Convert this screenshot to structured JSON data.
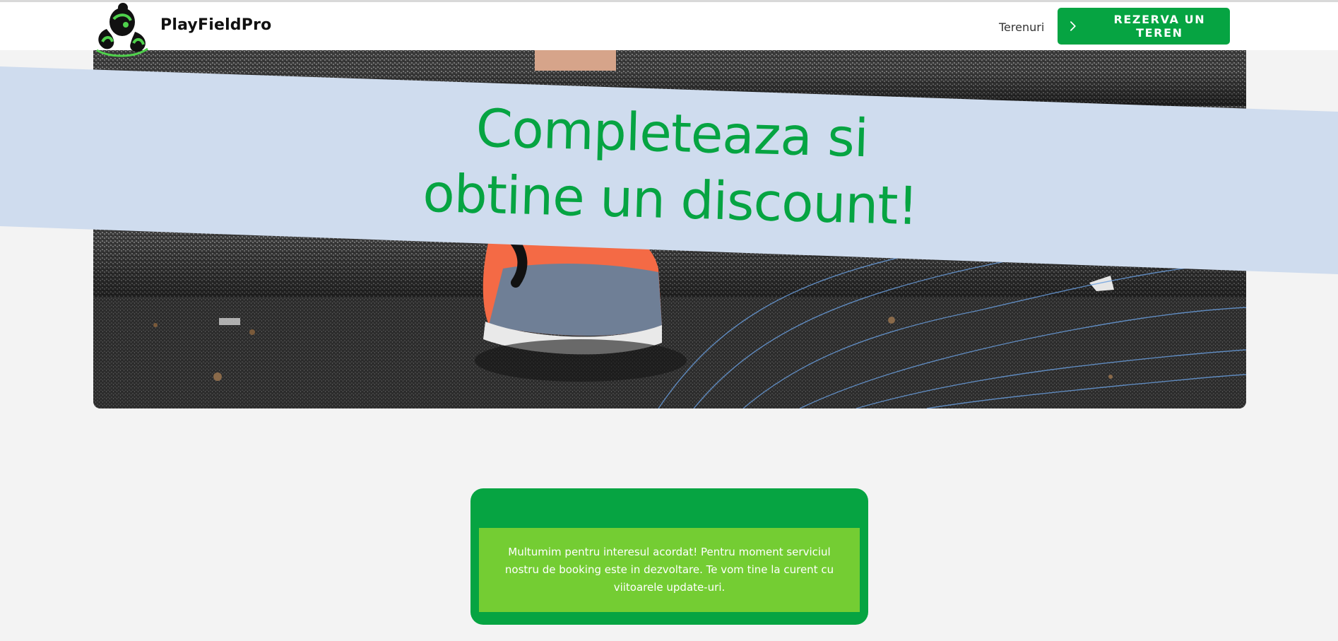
{
  "header": {
    "brand_name": "PlayFieldPro",
    "nav_link": "Terenuri",
    "cta_label": "REZERVA UN TEREN"
  },
  "banner": {
    "title_line1": "Completeaza si",
    "title_line2": "obtine un discount!"
  },
  "notice": {
    "message": "Multumim pentru interesul acordat! Pentru moment serviciul nostru de booking este in dezvoltare. Te vom tine la curent cu viitoarele update-uri."
  },
  "colors": {
    "brand_green": "#06a442",
    "light_green": "#74cd33",
    "banner_blue": "#cfdcee",
    "page_bg": "#f3f3f3"
  },
  "icons": {
    "logo": "brand-logo-icon",
    "cta": "chevron-right-icon"
  }
}
